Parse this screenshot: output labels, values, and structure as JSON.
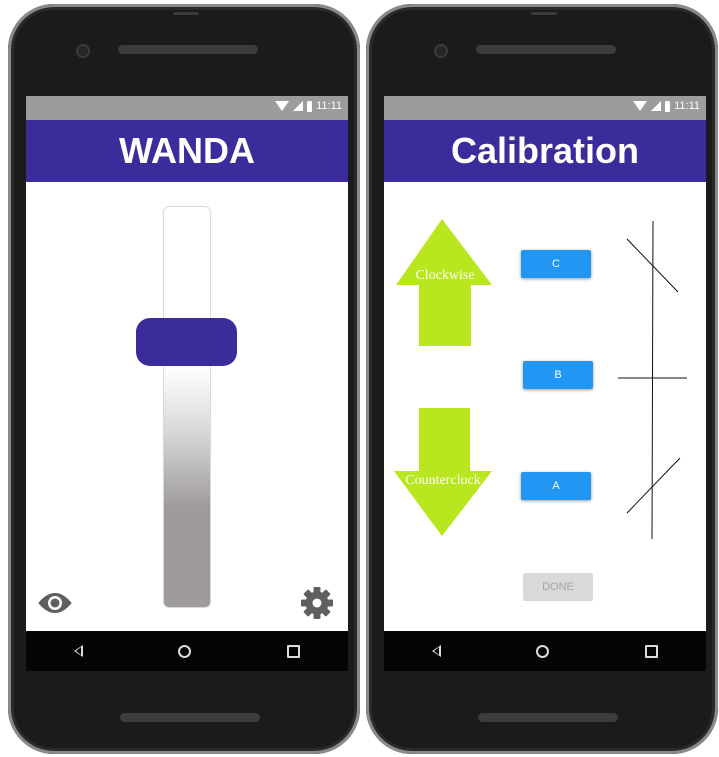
{
  "status": {
    "time": "11:11"
  },
  "slider_screen": {
    "title": "WANDA",
    "slider_level": 0.6,
    "icons": {
      "left": "eye-icon",
      "right": "gear-icon"
    }
  },
  "calibration_screen": {
    "title": "Calibration",
    "arrows": {
      "up_label": "Clockwise",
      "down_label": "Counterclock"
    },
    "buttons": {
      "c": "C",
      "b": "B",
      "a": "A",
      "done": "DONE"
    }
  },
  "colors": {
    "appbar": "#3a2c9a",
    "arrow": "#b8e61f",
    "button": "#2196f3",
    "thumb": "#3a2c9a"
  },
  "nav": [
    "back-icon",
    "home-icon",
    "recents-icon"
  ]
}
